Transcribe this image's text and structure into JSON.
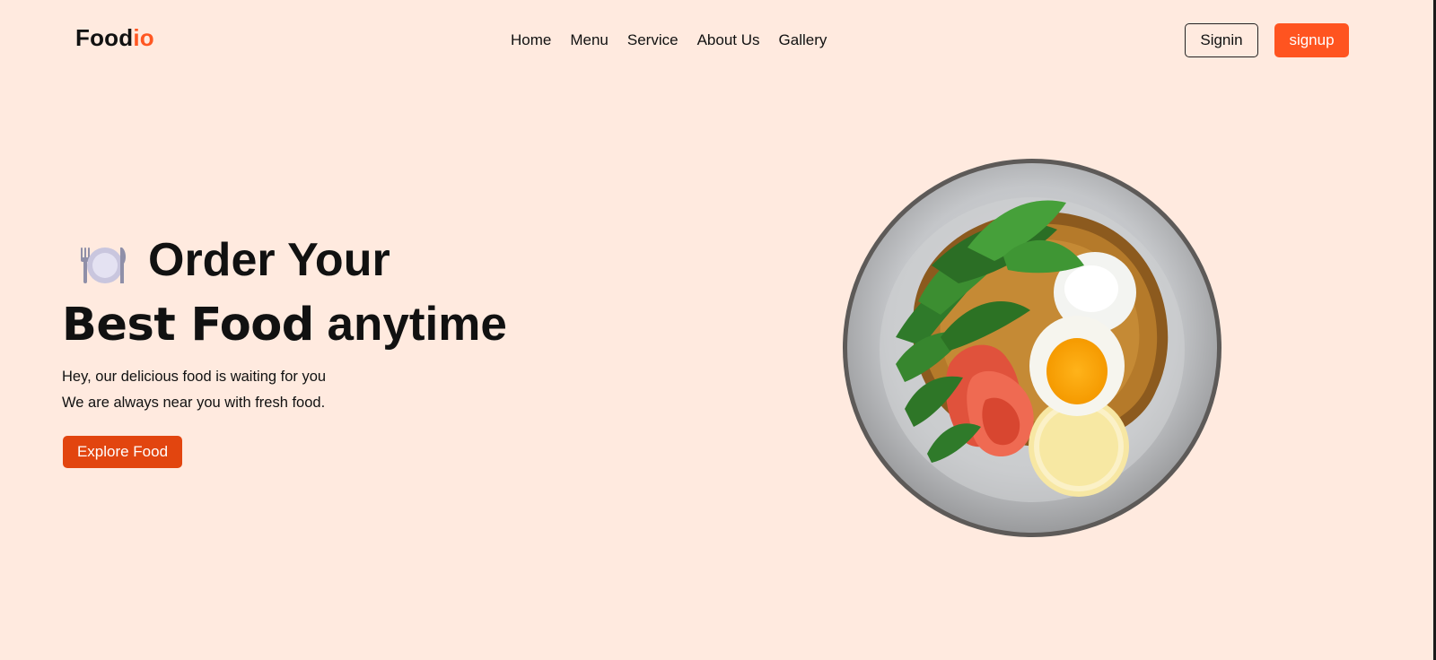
{
  "header": {
    "logo_part1": "Food",
    "logo_part2": "io",
    "nav": [
      "Home",
      "Menu",
      "Service",
      "About Us",
      "Gallery"
    ],
    "signin_label": "Signin",
    "signup_label": "signup"
  },
  "hero": {
    "heading_line1": "Order Your",
    "heading_bold": "Best Food",
    "heading_rest": " anytime",
    "subtitle_line1": "Hey, our delicious food is waiting for you",
    "subtitle_line2": "We are always near you with fresh food.",
    "cta_label": "Explore Food",
    "icon": "fork-knife-plate-icon",
    "image": "food-plate-salad-salmon-egg"
  },
  "colors": {
    "background": "#ffeadf",
    "accent": "#ff5722",
    "cta": "#e2450f"
  }
}
